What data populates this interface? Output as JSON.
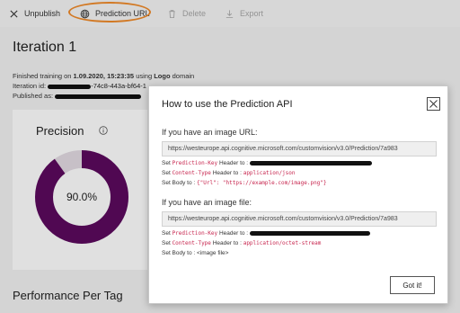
{
  "toolbar": {
    "unpublish_label": "Unpublish",
    "prediction_url_label": "Prediction URL",
    "delete_label": "Delete",
    "export_label": "Export",
    "highlight_color": "#f08a2a"
  },
  "iteration": {
    "title": "Iteration 1",
    "finished_prefix": "Finished training on ",
    "finished_date": "1.09.2020, 15:23:35",
    "finished_mid": " using ",
    "domain_name": "Logo",
    "finished_suffix": " domain",
    "id_label": "Iteration id: ",
    "id_visible": "-74c8-443a-bf64-1",
    "published_label": "Published as: "
  },
  "precision_card": {
    "title": "Precision",
    "value_text": "90.0%",
    "value": 0.9,
    "ring_color": "#5c0a5e"
  },
  "performance": {
    "title": "Performance Per Tag"
  },
  "dialog": {
    "title": "How to use the Prediction API",
    "image_url_section": {
      "heading": "If you have an image URL:",
      "url": "https://westeurope.api.cognitive.microsoft.com/customvision/v3.0/Prediction/7a983",
      "set1_prefix": "Set ",
      "set1_key": "Prediction-Key",
      "set1_suffix": " Header to :",
      "set2_prefix": "Set ",
      "set2_key": "Content-Type",
      "set2_mid": " Header to : ",
      "set2_value": "application/json",
      "set3_prefix": "Set Body to : ",
      "set3_value": "{\"Url\": \"https://example.com/image.png\"}"
    },
    "image_file_section": {
      "heading": "If you have an image file:",
      "url": "https://westeurope.api.cognitive.microsoft.com/customvision/v3.0/Prediction/7a983",
      "set1_prefix": "Set ",
      "set1_key": "Prediction-Key",
      "set1_suffix": " Header to :",
      "set2_prefix": "Set ",
      "set2_key": "Content-Type",
      "set2_mid": " Header to : ",
      "set2_value": "application/octet-stream",
      "set3_text": "Set Body to : <image file>"
    },
    "gotit_label": "Got it!"
  },
  "icons": {
    "unpublish": "close-x-icon",
    "prediction_url": "globe-icon",
    "delete": "trash-icon",
    "export": "download-icon",
    "info": "info-icon",
    "dialog_close": "close-icon"
  }
}
